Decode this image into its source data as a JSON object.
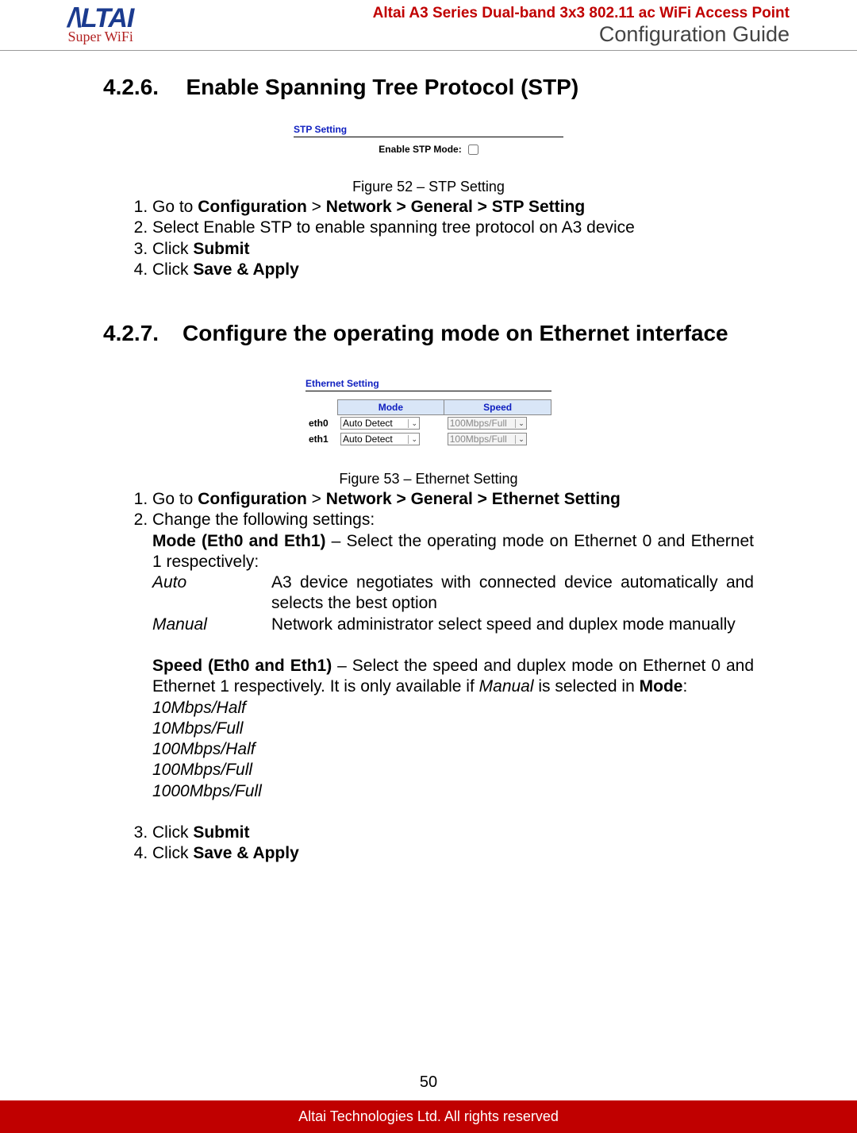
{
  "header": {
    "logo_main": "/\\LTAI",
    "logo_sub": "Super WiFi",
    "title": "Altai A3 Series Dual-band 3x3 802.11 ac WiFi Access Point",
    "subtitle": "Configuration Guide"
  },
  "s426": {
    "num": "4.2.6.",
    "title": "Enable Spanning Tree Protocol (STP)",
    "stp_heading": "STP Setting",
    "stp_label": "Enable STP Mode:",
    "fig": "Figure 52 – STP Setting",
    "steps": {
      "s1a": "Go to ",
      "s1b": "Configuration",
      "s1c": " > ",
      "s1d": "Network > General > STP Setting",
      "s2": "Select Enable STP to enable spanning tree protocol on A3 device",
      "s3a": "Click ",
      "s3b": "Submit",
      "s4a": "Click ",
      "s4b": "Save & Apply"
    }
  },
  "s427": {
    "num": "4.2.7.",
    "title": "Configure the operating mode on Ethernet interface",
    "eth_heading": "Ethernet Setting",
    "th_mode": "Mode",
    "th_speed": "Speed",
    "rows": {
      "r0": {
        "name": "eth0",
        "mode": "Auto Detect",
        "speed": "100Mbps/Full"
      },
      "r1": {
        "name": "eth1",
        "mode": "Auto Detect",
        "speed": "100Mbps/Full"
      }
    },
    "fig": "Figure 53 – Ethernet Setting",
    "step1a": "Go to ",
    "step1b": "Configuration",
    "step1c": " > ",
    "step1d": "Network > General > Ethernet Setting",
    "step2": "Change the following settings:",
    "mode_label": "Mode (Eth0 and Eth1)",
    "mode_text": " – Select the operating mode on Ethernet 0 and Ethernet 1 respectively:",
    "auto_k": "Auto",
    "auto_v": "A3 device negotiates with connected device automatically and selects the best option",
    "manual_k": "Manual",
    "manual_v": "Network administrator select speed and duplex mode manually",
    "speed_label": "Speed (Eth0 and Eth1)",
    "speed_text_a": " – Select the speed and duplex mode on Ethernet 0 and Ethernet 1 respectively. It is only available if ",
    "speed_text_b": "Manual",
    "speed_text_c": " is selected in ",
    "speed_text_d": "Mode",
    "speed_text_e": ":",
    "opt1": "10Mbps/Half",
    "opt2": "10Mbps/Full",
    "opt3": "100Mbps/Half",
    "opt4": "100Mbps/Full",
    "opt5": "1000Mbps/Full",
    "step3a": "Click ",
    "step3b": "Submit",
    "step4a": "Click ",
    "step4b": "Save & Apply"
  },
  "page_num": "50",
  "footer": "Altai Technologies Ltd. All rights reserved"
}
